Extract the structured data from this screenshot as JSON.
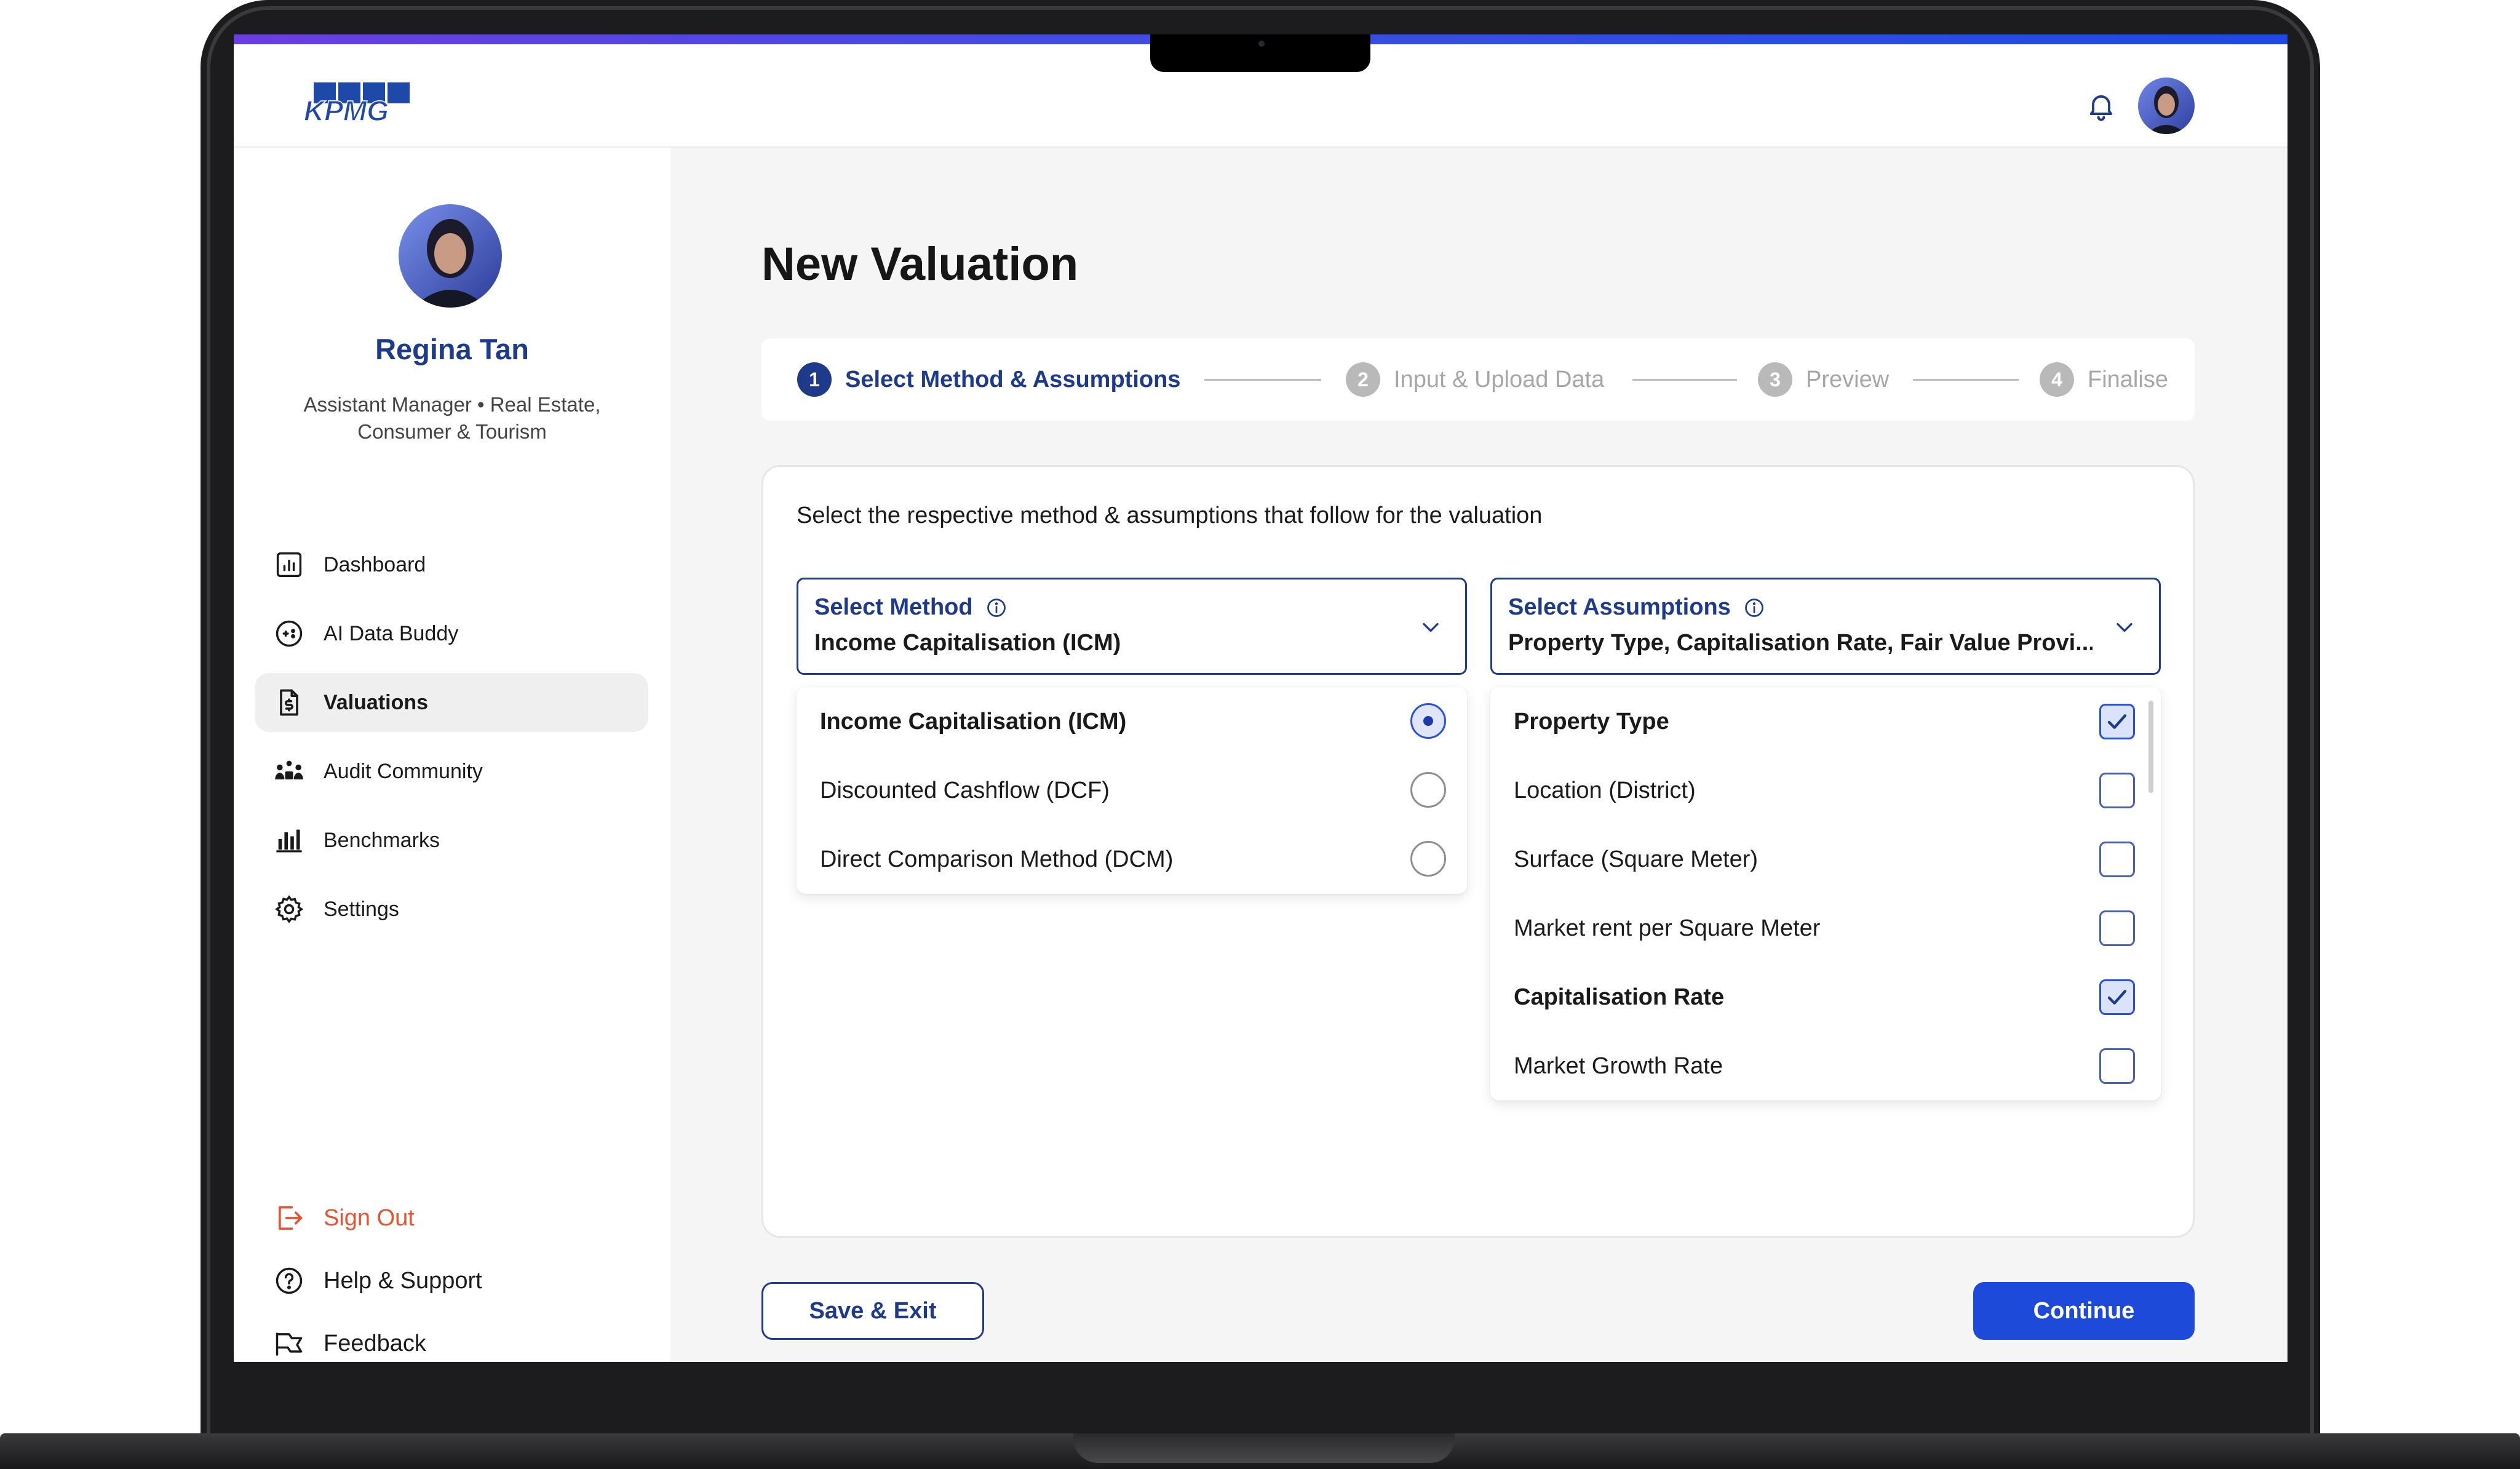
{
  "brand": {
    "logo_text": "KPMG",
    "accent": "#1e3a8a",
    "primary": "#1d4ad8",
    "signout_color": "#e5532f"
  },
  "header": {
    "notification_icon": "bell-icon"
  },
  "profile": {
    "name": "Regina Tan",
    "role": "Assistant Manager • Real Estate, Consumer & Tourism"
  },
  "sidebar": {
    "items": [
      {
        "label": "Dashboard",
        "icon": "chart-icon"
      },
      {
        "label": "AI Data Buddy",
        "icon": "ai-icon"
      },
      {
        "label": "Valuations",
        "icon": "document-dollar-icon",
        "active": true
      },
      {
        "label": "Audit Community",
        "icon": "community-icon"
      },
      {
        "label": "Benchmarks",
        "icon": "bar-chart-icon"
      },
      {
        "label": "Settings",
        "icon": "gear-icon"
      }
    ],
    "bottom": [
      {
        "label": "Sign Out",
        "icon": "sign-out-icon"
      },
      {
        "label": "Help & Support",
        "icon": "help-icon"
      },
      {
        "label": "Feedback",
        "icon": "megaphone-icon"
      }
    ]
  },
  "main": {
    "title": "New Valuation",
    "steps": [
      {
        "num": "1",
        "label": "Select Method & Assumptions",
        "active": true
      },
      {
        "num": "2",
        "label": "Input & Upload Data"
      },
      {
        "num": "3",
        "label": "Preview"
      },
      {
        "num": "4",
        "label": "Finalise"
      }
    ],
    "instructions": "Select the respective method & assumptions that follow for the valuation",
    "method": {
      "label": "Select Method",
      "value": "Income Capitalisation (ICM)",
      "options": [
        {
          "label": "Income Capitalisation (ICM)",
          "selected": true
        },
        {
          "label": "Discounted Cashflow (DCF)",
          "selected": false
        },
        {
          "label": "Direct Comparison Method (DCM)",
          "selected": false
        }
      ]
    },
    "assumptions": {
      "label": "Select Assumptions",
      "value": "Property Type, Capitalisation Rate, Fair Value Provi...",
      "options": [
        {
          "label": "Property Type",
          "checked": true
        },
        {
          "label": "Location (District)",
          "checked": false
        },
        {
          "label": "Surface (Square Meter)",
          "checked": false
        },
        {
          "label": "Market rent per Square Meter",
          "checked": false
        },
        {
          "label": "Capitalisation Rate",
          "checked": true
        },
        {
          "label": "Market Growth Rate",
          "checked": false
        }
      ]
    },
    "buttons": {
      "save_exit": "Save & Exit",
      "continue": "Continue"
    }
  }
}
